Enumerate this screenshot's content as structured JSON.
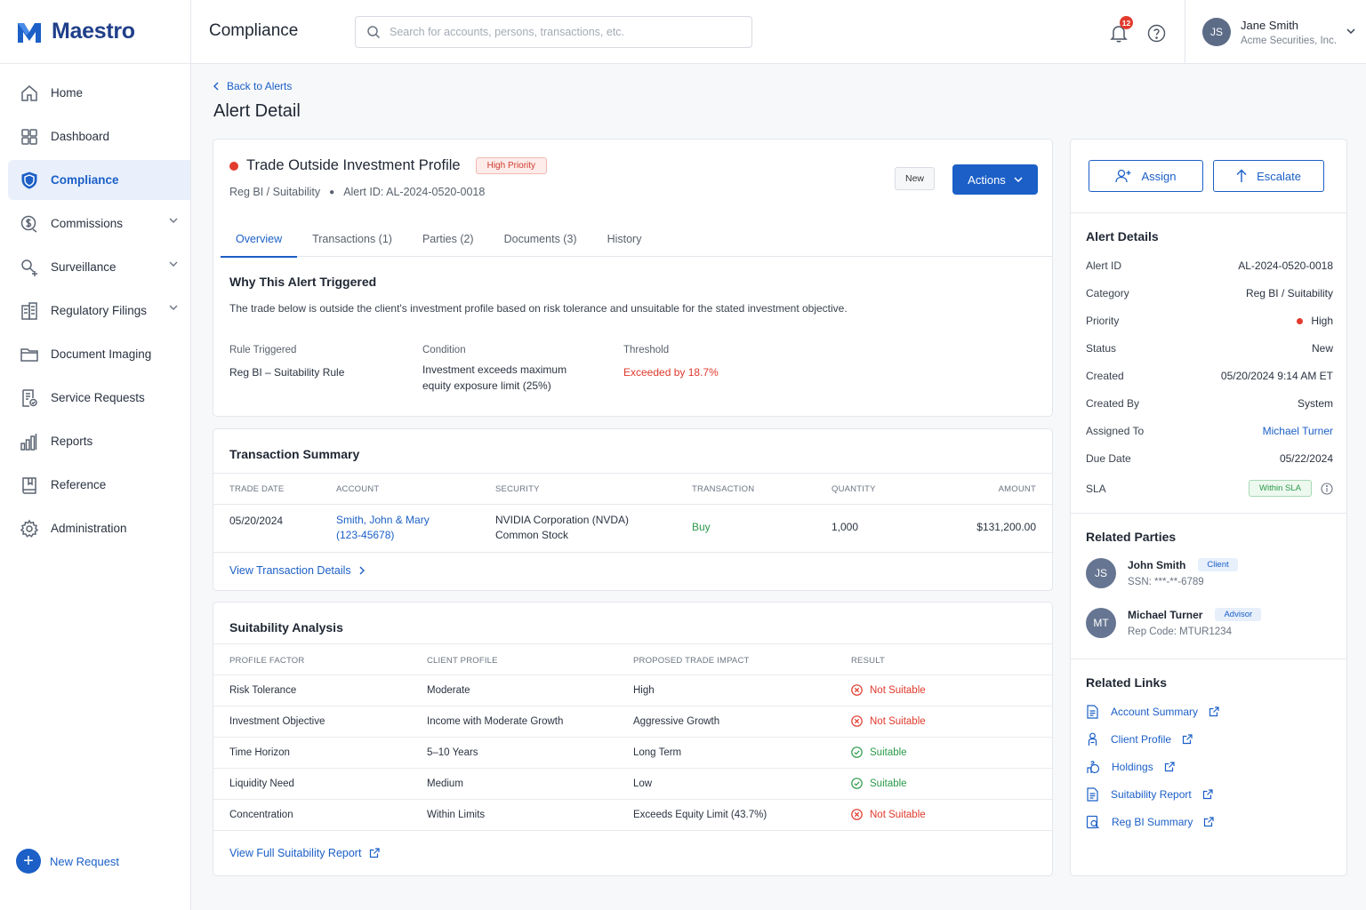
{
  "brand": {
    "name": "Maestro"
  },
  "sidebar": {
    "items": [
      {
        "label": "Home",
        "icon": "home-icon"
      },
      {
        "label": "Dashboard",
        "icon": "dashboard-icon"
      },
      {
        "label": "Compliance",
        "icon": "shield-icon",
        "active": true
      },
      {
        "label": "Commissions",
        "icon": "commissions-icon",
        "expandable": true
      },
      {
        "label": "Surveillance",
        "icon": "surveillance-icon",
        "expandable": true
      },
      {
        "label": "Regulatory Filings",
        "icon": "building-icon",
        "expandable": true
      },
      {
        "label": "Document Imaging",
        "icon": "folder-icon"
      },
      {
        "label": "Service Requests",
        "icon": "request-icon"
      },
      {
        "label": "Reports",
        "icon": "reports-icon"
      },
      {
        "label": "Reference",
        "icon": "book-icon"
      },
      {
        "label": "Administration",
        "icon": "gear-icon"
      }
    ],
    "new_request_label": "New Request"
  },
  "header": {
    "title": "Compliance",
    "search_placeholder": "Search for accounts, persons, transactions, etc.",
    "notification_count": "12",
    "user": {
      "initials": "JS",
      "name": "Jane Smith",
      "org": "Acme Securities, Inc."
    }
  },
  "page": {
    "back_label": "Back to Alerts",
    "title": "Alert Detail"
  },
  "alert": {
    "title": "Trade Outside Investment Profile",
    "priority_badge": "High Priority",
    "category": "Reg BI / Suitability",
    "alert_id_text": "Alert ID: AL-2024-0520-0018",
    "status_badge": "New",
    "actions_label": "Actions",
    "tabs": [
      "Overview",
      "Transactions (1)",
      "Parties (2)",
      "Documents (3)",
      "History"
    ],
    "why": {
      "title": "Why This Alert Triggered",
      "text": "The trade below is outside the client's investment profile based on risk tolerance and unsuitable for the stated investment objective.",
      "rule_label": "Rule Triggered",
      "rule_value": "Reg BI – Suitability Rule",
      "condition_label": "Condition",
      "condition_value_1": "Investment exceeds maximum",
      "condition_value_2": "equity exposure limit (25%)",
      "threshold_label": "Threshold",
      "threshold_value": "Exceeded by 18.7%"
    }
  },
  "transaction_summary": {
    "title": "Transaction Summary",
    "headers": [
      "TRADE DATE",
      "ACCOUNT",
      "SECURITY",
      "TRANSACTION",
      "QUANTITY",
      "AMOUNT"
    ],
    "row": {
      "trade_date": "05/20/2024",
      "account_1": "Smith, John & Mary",
      "account_2": "(123-45678)",
      "security_1": "NVIDIA Corporation (NVDA)",
      "security_2": "Common Stock",
      "transaction": "Buy",
      "quantity": "1,000",
      "amount": "$131,200.00"
    },
    "view_link": "View Transaction Details"
  },
  "suitability": {
    "title": "Suitability Analysis",
    "headers": [
      "PROFILE FACTOR",
      "CLIENT PROFILE",
      "PROPOSED TRADE IMPACT",
      "RESULT"
    ],
    "rows": [
      {
        "factor": "Risk Tolerance",
        "client": "Moderate",
        "impact": "High",
        "result": "Not Suitable",
        "ok": false
      },
      {
        "factor": "Investment Objective",
        "client": "Income with Moderate Growth",
        "impact": "Aggressive Growth",
        "result": "Not Suitable",
        "ok": false
      },
      {
        "factor": "Time Horizon",
        "client": "5–10 Years",
        "impact": "Long Term",
        "result": "Suitable",
        "ok": true
      },
      {
        "factor": "Liquidity Need",
        "client": "Medium",
        "impact": "Low",
        "result": "Suitable",
        "ok": true
      },
      {
        "factor": "Concentration",
        "client": "Within Limits",
        "impact": "Exceeds Equity Limit (43.7%)",
        "result": "Not Suitable",
        "ok": false
      }
    ],
    "view_link": "View Full Suitability Report"
  },
  "side": {
    "assign_label": "Assign",
    "escalate_label": "Escalate",
    "details_title": "Alert Details",
    "details": [
      {
        "key": "Alert ID",
        "value": "AL-2024-0520-0018"
      },
      {
        "key": "Category",
        "value": "Reg BI / Suitability"
      },
      {
        "key": "Priority",
        "value": "High"
      },
      {
        "key": "Status",
        "value": "New"
      },
      {
        "key": "Created",
        "value": "05/20/2024 9:14 AM ET"
      },
      {
        "key": "Created By",
        "value": "System"
      },
      {
        "key": "Assigned To",
        "value": "Michael Turner"
      },
      {
        "key": "Due Date",
        "value": "05/22/2024"
      },
      {
        "key": "SLA",
        "value": "Within SLA"
      }
    ],
    "parties_title": "Related Parties",
    "parties": [
      {
        "initials": "JS",
        "name": "John Smith",
        "role": "Client",
        "sub": "SSN: ***-**-6789"
      },
      {
        "initials": "MT",
        "name": "Michael Turner",
        "role": "Advisor",
        "sub": "Rep Code: MTUR1234"
      }
    ],
    "links_title": "Related Links",
    "links": [
      "Account Summary",
      "Client Profile",
      "Holdings",
      "Suitability Report",
      "Reg BI Summary"
    ]
  },
  "colors": {
    "accent": "#1b5fc7",
    "danger": "#e23b2e",
    "success": "#2a9a4a",
    "brand": "#1f3f8a"
  }
}
